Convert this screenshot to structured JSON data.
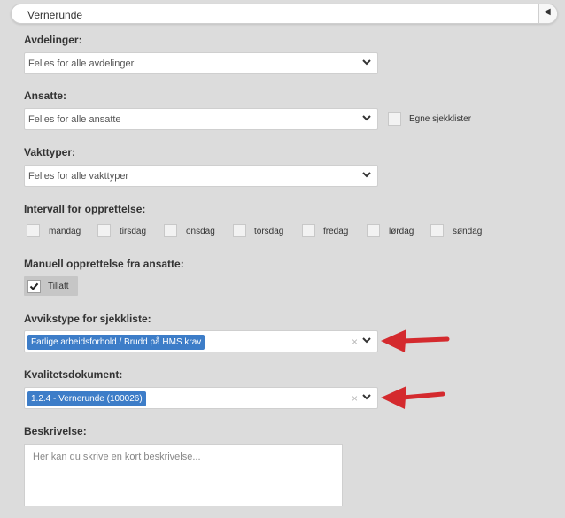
{
  "header": {
    "title": "Vernerunde",
    "toggle_icon": "caret-left-icon"
  },
  "fields": {
    "departments": {
      "label": "Avdelinger:",
      "value": "Felles for alle avdelinger"
    },
    "employees": {
      "label": "Ansatte:",
      "value": "Felles for alle ansatte",
      "own_checklists_label": "Egne sjekklister",
      "own_checklists_checked": false
    },
    "shift_types": {
      "label": "Vakttyper:",
      "value": "Felles for alle vakttyper"
    },
    "interval": {
      "label": "Intervall for opprettelse:",
      "days": [
        {
          "label": "mandag",
          "checked": false
        },
        {
          "label": "tirsdag",
          "checked": false
        },
        {
          "label": "onsdag",
          "checked": false
        },
        {
          "label": "torsdag",
          "checked": false
        },
        {
          "label": "fredag",
          "checked": false
        },
        {
          "label": "lørdag",
          "checked": false
        },
        {
          "label": "søndag",
          "checked": false
        }
      ]
    },
    "manual": {
      "label": "Manuell opprettelse fra ansatte:",
      "option_label": "Tillatt",
      "checked": true
    },
    "deviation_type": {
      "label": "Avvikstype for sjekkliste:",
      "tag": "Farlige arbeidsforhold / Brudd på HMS krav",
      "clear": "×"
    },
    "quality_document": {
      "label": "Kvalitetsdokument:",
      "tag": "1.2.4 - Vernerunde (100026)",
      "clear": "×"
    },
    "description": {
      "label": "Beskrivelse:",
      "placeholder": "Her kan du skrive en kort beskrivelse..."
    }
  },
  "colors": {
    "tag_bg": "#3d7dc8",
    "arrow": "#d42a2e",
    "background": "#dcdcdc"
  }
}
